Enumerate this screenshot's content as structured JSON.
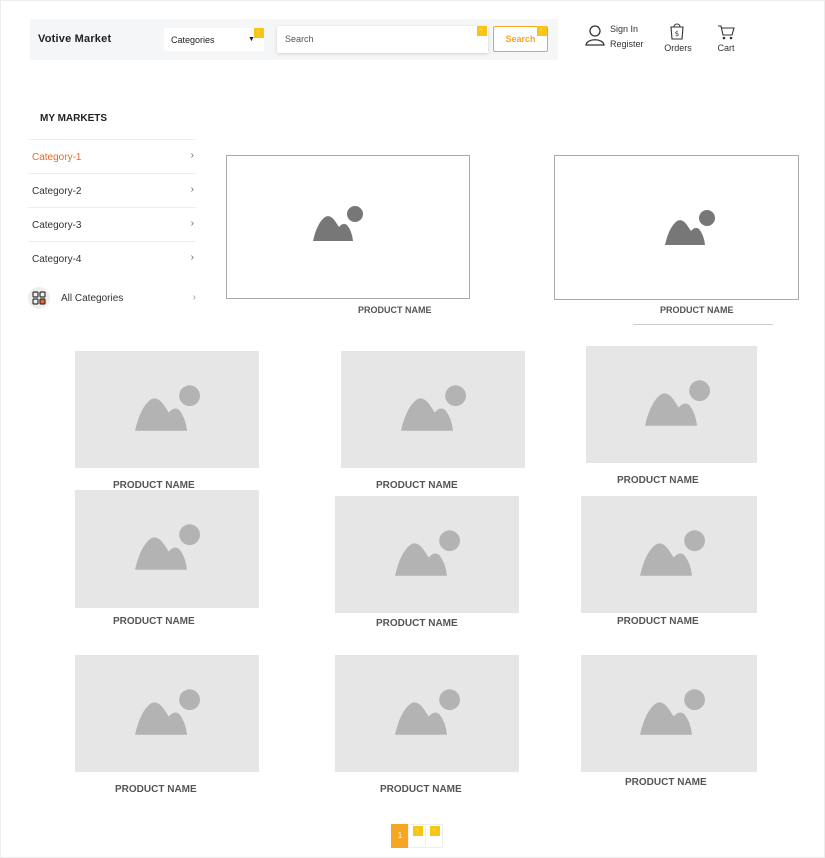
{
  "header": {
    "logo": "Votive Market",
    "category_select": "Categories",
    "search_placeholder": "Search",
    "search_button": "Search",
    "sign_in": "Sign In",
    "register": "Register",
    "orders": "Orders",
    "cart": "Cart"
  },
  "sidebar": {
    "title": "MY MARKETS",
    "items": [
      {
        "label": "Category-1"
      },
      {
        "label": "Category-2"
      },
      {
        "label": "Category-3"
      },
      {
        "label": "Category-4"
      }
    ],
    "all_categories": "All Categories"
  },
  "products": {
    "featured": [
      {
        "name": "PRODUCT NAME"
      },
      {
        "name": "PRODUCT NAME"
      }
    ],
    "grid": [
      {
        "name": "PRODUCT NAME"
      },
      {
        "name": "PRODUCT NAME"
      },
      {
        "name": "PRODUCT NAME"
      },
      {
        "name": "PRODUCT NAME"
      },
      {
        "name": "PRODUCT NAME"
      },
      {
        "name": "PRODUCT NAME"
      },
      {
        "name": "PRODUCT NAME"
      },
      {
        "name": "PRODUCT NAME"
      },
      {
        "name": "PRODUCT NAME"
      }
    ]
  },
  "pagination": {
    "current": "1"
  },
  "colors": {
    "accent": "#f5a623",
    "active_category": "#f26522",
    "placeholder_bg": "#e6e6e6",
    "placeholder_icon": "#b3b3b3"
  }
}
